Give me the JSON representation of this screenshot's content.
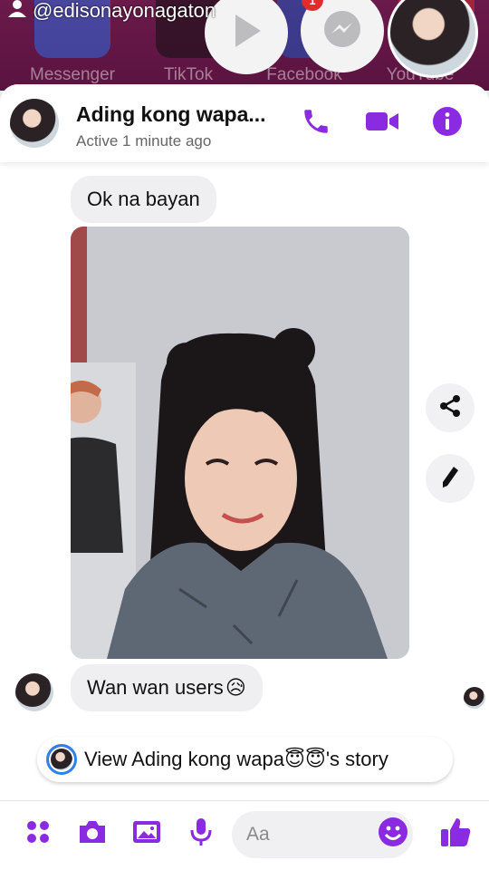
{
  "watermark": {
    "handle": "@edisonayonagaton"
  },
  "home_apps": [
    {
      "label": "Messenger",
      "color": "#2e6be6"
    },
    {
      "label": "TikTok",
      "color": "#111111"
    },
    {
      "label": "Facebook",
      "color": "#1b57c5"
    },
    {
      "label": "YouTube",
      "color": "#d92b2b"
    }
  ],
  "chat_heads": {
    "notification_badge": "1"
  },
  "header": {
    "title": "Ading kong wapa...",
    "status": "Active 1 minute ago",
    "accent_color": "#8a2be2"
  },
  "messages": [
    {
      "text": "Ok na bayan"
    },
    {
      "text": "Wan wan users",
      "emoji": "😥"
    }
  ],
  "story_prompt": {
    "prefix": "View Ading kong wapa",
    "emoji": "😇😇",
    "suffix": "'s story"
  },
  "composer": {
    "placeholder": "Aa",
    "icons": [
      "apps-grid-icon",
      "camera-icon",
      "gallery-icon",
      "microphone-icon",
      "emoji-icon",
      "thumbs-up-icon"
    ]
  }
}
